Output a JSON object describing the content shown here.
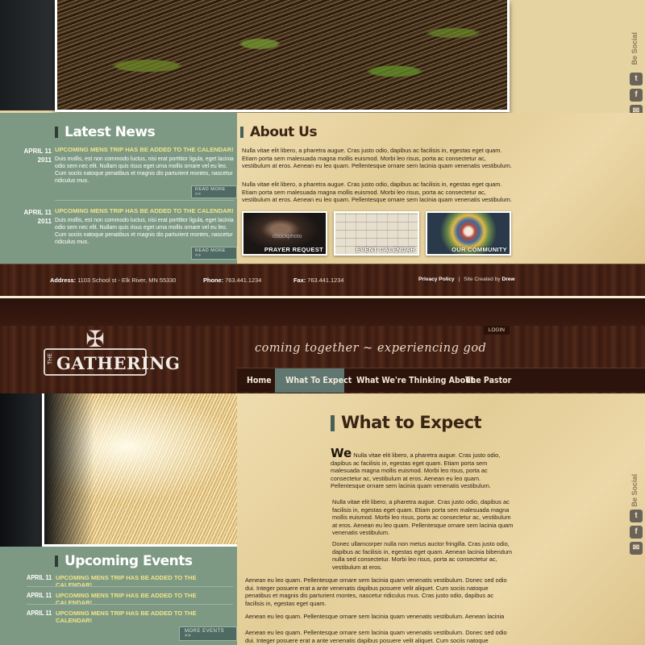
{
  "top": {
    "social_label": "Be Social",
    "latest_news_title": "Latest News",
    "about_title": "About Us",
    "news": [
      {
        "date_month": "APRIL 11",
        "date_year": "2011",
        "title": "UPCOMING MENS TRIP HAS BE ADDED TO THE CALENDAR!",
        "body": "Duis mollis, est non commodo luctus, nisi erat porttitor ligula, eget lacinia odio sem nec elit. Nullam quis risus eget urna mollis ornare vel eu leo. Cum sociis natoque penatibus et magnis dis parturient montes, nascetur ridiculus mus.",
        "more": "READ MORE >>"
      },
      {
        "date_month": "APRIL 11",
        "date_year": "2011",
        "title": "UPCOMING MENS TRIP HAS BE ADDED TO THE CALENDAR!",
        "body": "Duis mollis, est non commodo luctus, nisi erat porttitor ligula, eget lacinia odio sem nec elit. Nullam quis risus eget urna mollis ornare vel eu leo. Cum sociis natoque penatibus et magnis dis parturient montes, nascetur ridiculus mus.",
        "more": "READ MORE >>"
      }
    ],
    "about_paragraphs": [
      "Nulla vitae elit libero, a pharetra augue. Cras justo odio, dapibus ac facilisis in, egestas eget quam. Etiam porta sem malesuada magna mollis euismod. Morbi leo risus, porta ac consectetur ac, vestibulum at eros. Aenean eu leo quam. Pellentesque ornare sem lacinia quam venenatis vestibulum.",
      "Nulla vitae elit libero, a pharetra augue. Cras justo odio, dapibus ac facilisis in, egestas eget quam. Etiam porta sem malesuada magna mollis euismod. Morbi leo risus, porta ac consectetur ac, vestibulum at eros. Aenean eu leo quam. Pellentesque ornare sem lacinia quam venenatis vestibulum."
    ],
    "thumbnails": [
      {
        "caption": "PRAYER REQUEST",
        "watermark": "iStockphoto"
      },
      {
        "caption": "EVENT CALENDAR"
      },
      {
        "caption": "OUR COMMUNITY"
      }
    ],
    "footer": {
      "address_label": "Address:",
      "address": "1103 School st - Elk River, MN 55330",
      "phone_label": "Phone:",
      "phone": "763.441.1234",
      "fax_label": "Fax:",
      "fax": "763.441.1234",
      "privacy": "Privacy Policy",
      "separator": "|",
      "credit_prefix": "Site Created by",
      "credit_name": "Drew"
    }
  },
  "header": {
    "login": "LOGIN",
    "logo_the": "THE",
    "logo_text": "GATHERING",
    "tagline": "coming together ~ experiencing god",
    "nav": [
      "Home",
      "What To Expect",
      "What We're Thinking About",
      "The Pastor"
    ],
    "active_nav_index": 1
  },
  "bottom": {
    "events_title": "Upcoming Events",
    "events": [
      {
        "date": "APRIL 11",
        "title": "UPCOMING MENS TRIP HAS BE ADDED TO THE CALENDAR!"
      },
      {
        "date": "APRIL 11",
        "title": "UPCOMING MENS TRIP HAS BE ADDED TO THE CALENDAR!"
      },
      {
        "date": "APRIL 11",
        "title": "UPCOMING MENS TRIP HAS BE ADDED TO THE CALENDAR!"
      }
    ],
    "more_events": "MORE EVENTS >>",
    "main_title": "What to Expect",
    "dropcap": "We",
    "p1_rest": "Nulla vitae elit libero, a pharetra augue. Cras justo odio, dapibus ac facilisis in, egestas eget quam. Etiam porta sem malesuada magna mollis euismod. Morbi leo risus, porta ac consectetur ac, vestibulum at eros. Aenean eu leo quam. Pellentesque ornare sem lacinia quam venenatis vestibulum.",
    "p2": "Nulla vitae elit libero, a pharetra augue. Cras justo odio, dapibus ac facilisis in, egestas eget quam. Etiam porta sem malesuada magna mollis euismod. Morbi leo risus, porta ac consectetur ac, vestibulum at eros. Aenean eu leo quam. Pellentesque ornare sem lacinia quam venenatis vestibulum.",
    "p3": "Donec ullamcorper nulla non metus auctor fringilla. Cras justo odio, dapibus ac facilisis in, egestas eget quam. Aenean lacinia bibendum nulla sed consectetur. Morbi leo risus, porta ac consectetur ac, vestibulum at eros.",
    "p4": "Aenean eu leo quam. Pellentesque ornare sem lacinia quam venenatis vestibulum. Donec sed odio dui. Integer posuere erat a ante venenatis dapibus posuere velit aliquet. Cum sociis natoque penatibus et magnis dis parturient montes, nascetur ridiculus mus. Cras justo odio, dapibus ac facilisis in, egestas eget quam.",
    "p5": "Aenean eu leo quam. Pellentesque ornare sem lacinia quam venenatis vestibulum. Aenean lacinia",
    "p6": "Aenean eu leo quam. Pellentesque ornare sem lacinia quam venenatis vestibulum. Donec sed odio dui. Integer posuere erat a ante venenatis dapibus posuere velit aliquet. Cum sociis natoque"
  },
  "social_icons": [
    "twitter-icon",
    "facebook-icon",
    "email-icon"
  ]
}
